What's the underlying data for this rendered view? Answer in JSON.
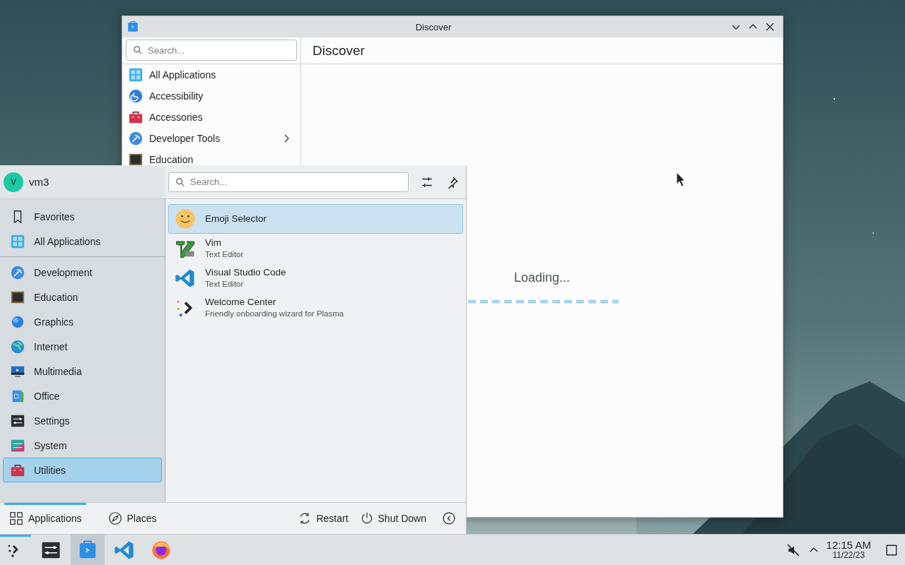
{
  "discover_window": {
    "title": "Discover",
    "search": {
      "placeholder": "Search..."
    },
    "page_title": "Discover",
    "categories": [
      {
        "label": "All Applications",
        "kind": "grid",
        "has_submenu": false
      },
      {
        "label": "Accessibility",
        "kind": "accessibility",
        "has_submenu": false
      },
      {
        "label": "Accessories",
        "kind": "toolbox",
        "has_submenu": false
      },
      {
        "label": "Developer Tools",
        "kind": "hammer",
        "has_submenu": true
      },
      {
        "label": "Education",
        "kind": "chalkboard",
        "has_submenu": false
      }
    ],
    "loading": {
      "text": "Loading..."
    }
  },
  "launcher": {
    "user": {
      "initial": "V",
      "name": "vm3"
    },
    "search": {
      "placeholder": "Search..."
    },
    "places": [
      {
        "label": "Favorites",
        "kind": "bookmark",
        "selected": false
      },
      {
        "label": "All Applications",
        "kind": "grid",
        "selected": false
      }
    ],
    "categories": [
      {
        "label": "Development",
        "kind": "hammer",
        "selected": false
      },
      {
        "label": "Education",
        "kind": "chalkboard",
        "selected": false
      },
      {
        "label": "Graphics",
        "kind": "sphere",
        "selected": false
      },
      {
        "label": "Internet",
        "kind": "globe",
        "selected": false
      },
      {
        "label": "Multimedia",
        "kind": "monitor",
        "selected": false
      },
      {
        "label": "Office",
        "kind": "document",
        "selected": false
      },
      {
        "label": "Settings",
        "kind": "settings-app",
        "selected": false
      },
      {
        "label": "System",
        "kind": "system",
        "selected": false
      },
      {
        "label": "Utilities",
        "kind": "toolbox",
        "selected": true
      }
    ],
    "apps": [
      {
        "name": "Emoji Selector",
        "kind": "smiley",
        "selected": true
      },
      {
        "name": "Vim",
        "description": "Text Editor",
        "kind": "vim",
        "selected": false
      },
      {
        "name": "Visual Studio Code",
        "description": "Text Editor",
        "kind": "vscode",
        "selected": false
      },
      {
        "name": "Welcome Center",
        "description": "Friendly onboarding wizard for Plasma",
        "kind": "welcome",
        "selected": false
      }
    ],
    "tabs": [
      {
        "label": "Applications",
        "kind": "grid-outline",
        "selected": true
      },
      {
        "label": "Places",
        "kind": "compass",
        "selected": false
      }
    ],
    "actions": [
      {
        "label": "Restart",
        "kind": "restart"
      },
      {
        "label": "Shut Down",
        "kind": "power"
      }
    ]
  },
  "taskbar": {
    "launcher": {
      "menu_open": true
    },
    "tasks": [
      {
        "kind": "settings-app",
        "active": false
      },
      {
        "kind": "discover",
        "active": true
      },
      {
        "kind": "vscode",
        "active": false
      },
      {
        "kind": "firefox",
        "active": false
      }
    ],
    "tray": {
      "volume_muted": true
    },
    "clock": {
      "time": "12:15 AM",
      "date": "11/22/23"
    }
  }
}
